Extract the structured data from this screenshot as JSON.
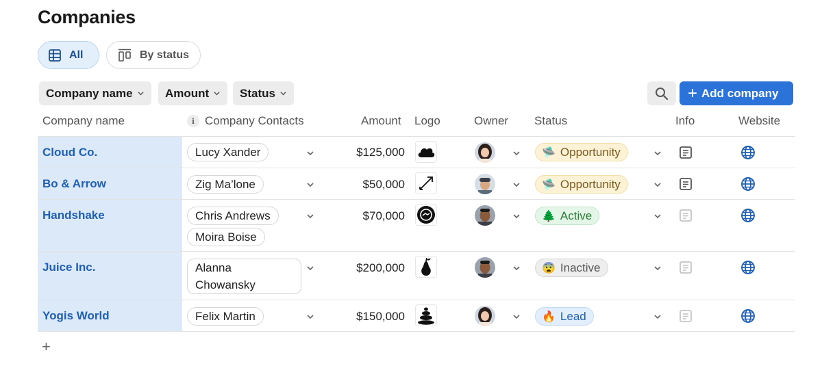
{
  "page": {
    "title": "Companies"
  },
  "views": {
    "all_label": "All",
    "by_status_label": "By status"
  },
  "filters": {
    "company_name": "Company name",
    "amount": "Amount",
    "status": "Status"
  },
  "actions": {
    "add_company": "Add company"
  },
  "columns": {
    "company_name": "Company name",
    "contacts": "Company Contacts",
    "contacts_info_glyph": "i",
    "amount": "Amount",
    "logo": "Logo",
    "owner": "Owner",
    "status": "Status",
    "info": "Info",
    "website": "Website"
  },
  "rows": [
    {
      "name": "Cloud Co.",
      "contacts": [
        "Lucy Xander"
      ],
      "amount": "$125,000",
      "logo": "cloud-logo",
      "owner": "avatar-woman",
      "status": "Opportunity",
      "status_emoji": "🛸",
      "info_active": true
    },
    {
      "name": "Bo & Arrow",
      "contacts": [
        "Zig Ma’lone"
      ],
      "amount": "$50,000",
      "logo": "arrow-logo",
      "owner": "avatar-man-cap",
      "status": "Opportunity",
      "status_emoji": "🛸",
      "info_active": true
    },
    {
      "name": "Handshake",
      "contacts": [
        "Chris Andrews",
        "Moira Boise"
      ],
      "amount": "$70,000",
      "logo": "handshake-logo",
      "owner": "avatar-man",
      "status": "Active",
      "status_emoji": "🌲",
      "info_active": false
    },
    {
      "name": "Juice Inc.",
      "contacts": [
        "Alanna Chowansky"
      ],
      "amount": "$200,000",
      "logo": "pear-logo",
      "owner": "avatar-man",
      "status": "Inactive",
      "status_emoji": "😨",
      "info_active": false
    },
    {
      "name": "Yogis World",
      "contacts": [
        "Felix Martin"
      ],
      "amount": "$150,000",
      "logo": "stones-logo",
      "owner": "avatar-woman",
      "status": "Lead",
      "status_emoji": "🔥",
      "info_active": false
    }
  ],
  "add_row_glyph": "+",
  "colors": {
    "accent": "#2b73d9",
    "name_cell_bg": "#dbe9f9",
    "link": "#1f5fb4"
  }
}
